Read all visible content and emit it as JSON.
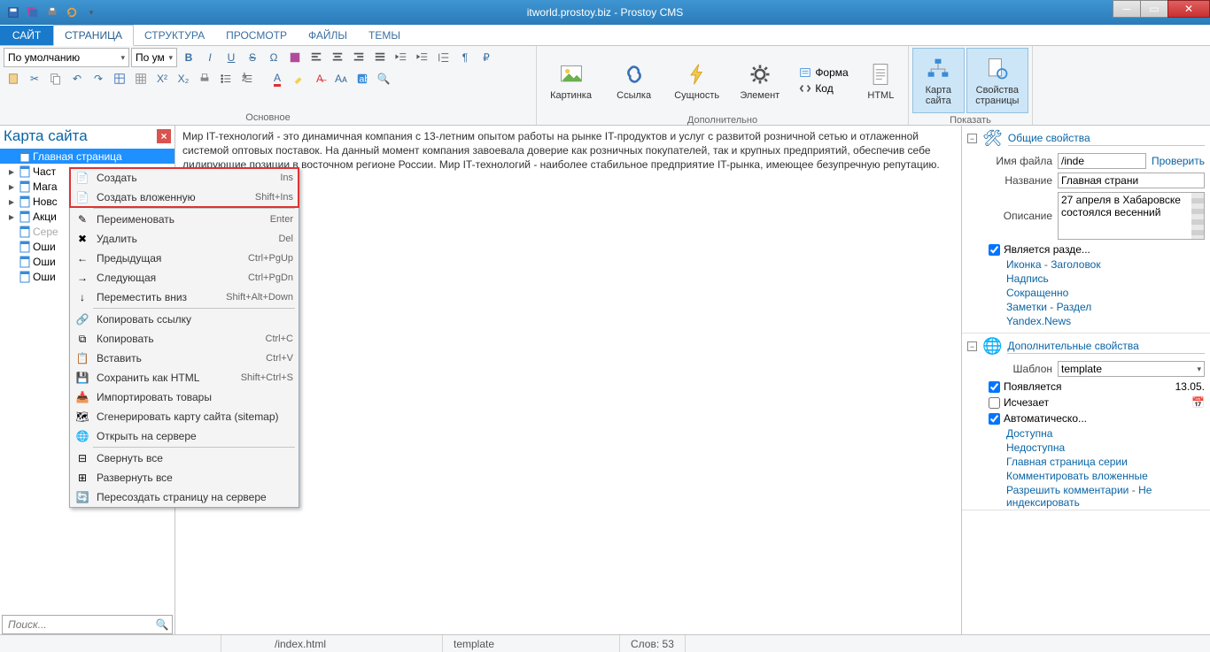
{
  "titlebar": {
    "title": "itworld.prostoy.biz - Prostoy CMS"
  },
  "tabs": {
    "file": "САЙТ",
    "items": [
      "СТРАНИЦА",
      "СТРУКТУРА",
      "ПРОСМОТР",
      "ФАЙЛЫ",
      "ТЕМЫ"
    ],
    "active": 0
  },
  "ribbon": {
    "style_default": "По умолчанию",
    "style_short": "По ум",
    "group_main": "Основное",
    "group_extra": "Дополнительно",
    "group_show": "Показать",
    "big": {
      "image": "Картинка",
      "link": "Ссылка",
      "entity": "Сущность",
      "element": "Элемент",
      "form": "Форма",
      "code": "Код",
      "html": "HTML",
      "sitemap": "Карта\nсайта",
      "pageprops": "Свойства\nстраницы"
    }
  },
  "sitemap": {
    "title": "Карта сайта",
    "search_placeholder": "Поиск...",
    "items": [
      {
        "label": "Главная страница",
        "sel": true,
        "arrow": false
      },
      {
        "label": "Част",
        "arrow": true
      },
      {
        "label": "Мага",
        "arrow": true
      },
      {
        "label": "Новс",
        "arrow": true
      },
      {
        "label": "Акци",
        "arrow": true
      },
      {
        "label": "Сере",
        "arrow": false,
        "gray": true
      },
      {
        "label": "Оши",
        "arrow": false
      },
      {
        "label": "Оши",
        "arrow": false
      },
      {
        "label": "Оши",
        "arrow": false
      }
    ]
  },
  "editor": {
    "text": "Мир IT-технологий - это динамичная компания с 13-летним опытом работы на рынке IT-продуктов и услуг с развитой розничной сетью и отлаженной системой оптовых поставок. На данный момент компания завоевала доверие как розничных покупателей, так и крупных предприятий, обеспечив себе лидирующие позиции в восточном регионе России. Мир IT-технологий - наиболее стабильное предприятие IT-рынка, имеющее безупречную репутацию."
  },
  "ctx": [
    {
      "ico": "new",
      "label": "Создать",
      "key": "Ins"
    },
    {
      "ico": "new-sub",
      "label": "Создать вложенную",
      "key": "Shift+Ins"
    },
    {
      "sep": true
    },
    {
      "ico": "rename",
      "label": "Переименовать",
      "key": "Enter"
    },
    {
      "ico": "del",
      "label": "Удалить",
      "key": "Del"
    },
    {
      "ico": "prev",
      "label": "Предыдущая",
      "key": "Ctrl+PgUp"
    },
    {
      "ico": "next",
      "label": "Следующая",
      "key": "Ctrl+PgDn"
    },
    {
      "ico": "movedown",
      "label": "Переместить вниз",
      "key": "Shift+Alt+Down"
    },
    {
      "sep": true
    },
    {
      "ico": "copylink",
      "label": "Копировать ссылку",
      "key": ""
    },
    {
      "ico": "copy",
      "label": "Копировать",
      "key": "Ctrl+C"
    },
    {
      "ico": "paste",
      "label": "Вставить",
      "key": "Ctrl+V"
    },
    {
      "ico": "savehtml",
      "label": "Сохранить как HTML",
      "key": "Shift+Ctrl+S"
    },
    {
      "ico": "import",
      "label": "Импортировать товары",
      "key": ""
    },
    {
      "ico": "sitemapgen",
      "label": "Сгенерировать карту сайта (sitemap)",
      "key": ""
    },
    {
      "ico": "openserver",
      "label": "Открыть на сервере",
      "key": ""
    },
    {
      "sep": true
    },
    {
      "ico": "collapse",
      "label": "Свернуть все",
      "key": ""
    },
    {
      "ico": "expand",
      "label": "Развернуть все",
      "key": ""
    },
    {
      "ico": "rebuild",
      "label": "Пересоздать страницу на сервере",
      "key": ""
    }
  ],
  "props": {
    "sec_common": "Общие свойства",
    "sec_extra": "Дополнительные свойства",
    "filename_lbl": "Имя файла",
    "filename": "/inde",
    "check": "Проверить",
    "title_lbl": "Название",
    "title": "Главная страни",
    "desc_lbl": "Описание",
    "desc": "27 апреля в Хабаровске состоялся весенний",
    "is_section": "Является разде...",
    "links1a": "Иконка",
    "links1b": "Заголовок",
    "links2": "Надпись",
    "links3": "Сокращенно",
    "links4a": "Заметки",
    "links4b": "Раздел",
    "links5": "Yandex.News",
    "template_lbl": "Шаблон",
    "template": "template",
    "appears": "Появляется",
    "appears_date": "13.05.",
    "disappears": "Исчезает",
    "auto": "Автоматическо...",
    "s1": "Доступна",
    "s2": "Недоступна",
    "s3": "Главная страница серии",
    "s4": "Комментировать вложенные",
    "s5": "Разрешить комментарии",
    "s5b": "Не индексировать"
  },
  "status": {
    "path": "/index.html",
    "tmpl": "template",
    "words": "Слов: 53"
  }
}
